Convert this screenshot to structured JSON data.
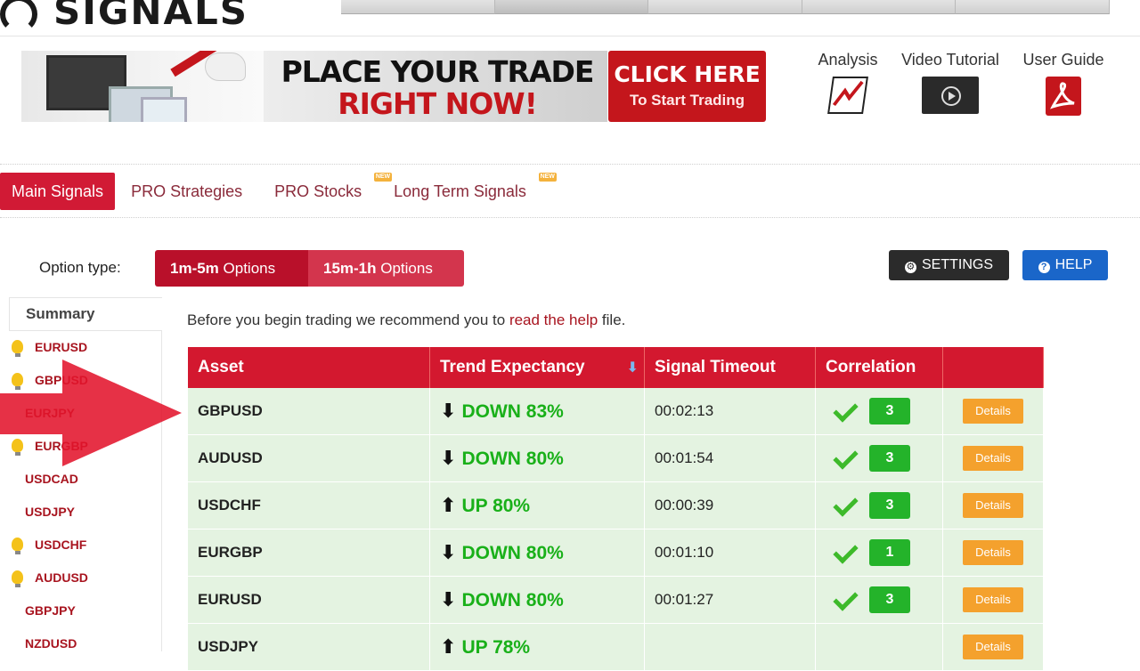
{
  "header": {
    "logo_text": "SIGNALS",
    "top_tabs": [
      "",
      "",
      "",
      "",
      ""
    ]
  },
  "banner": {
    "line1": "PLACE YOUR TRADE",
    "line2": "RIGHT NOW!",
    "cta_line1": "CLICK HERE",
    "cta_line2": "To Start Trading"
  },
  "utility": {
    "analysis": "Analysis",
    "video": "Video Tutorial",
    "guide": "User Guide"
  },
  "tabs": [
    {
      "label": "Main Signals",
      "active": true,
      "new": false
    },
    {
      "label": "PRO Strategies",
      "active": false,
      "new": false
    },
    {
      "label": "PRO Stocks",
      "active": false,
      "new": true
    },
    {
      "label": "Long Term Signals",
      "active": false,
      "new": true
    }
  ],
  "new_badge": "NEW",
  "options": {
    "label": "Option type:",
    "opt1_bold": "1m-5m",
    "opt1_rest": " Options",
    "opt2_bold": "15m-1h",
    "opt2_rest": " Options",
    "settings": "SETTINGS",
    "help": "HELP"
  },
  "summary": {
    "title": "Summary",
    "items": [
      {
        "label": "EURUSD",
        "bulb": true
      },
      {
        "label": "GBPUSD",
        "bulb": true
      },
      {
        "label": "EURJPY",
        "bulb": false
      },
      {
        "label": "EURGBP",
        "bulb": true
      },
      {
        "label": "USDCAD",
        "bulb": false
      },
      {
        "label": "USDJPY",
        "bulb": false
      },
      {
        "label": "USDCHF",
        "bulb": true
      },
      {
        "label": "AUDUSD",
        "bulb": true
      },
      {
        "label": "GBPJPY",
        "bulb": false
      },
      {
        "label": "NZDUSD",
        "bulb": false
      }
    ]
  },
  "intro": {
    "before": "Before you begin trading we recommend you to ",
    "link": "read the help",
    "after": " file."
  },
  "table": {
    "headers": [
      "Asset",
      "Trend Expectancy",
      "Signal Timeout",
      "Correlation",
      ""
    ],
    "rows": [
      {
        "asset": "GBPUSD",
        "dir": "down",
        "trend": "DOWN 83%",
        "timeout": "00:02:13",
        "corr": "3",
        "details": "Details"
      },
      {
        "asset": "AUDUSD",
        "dir": "down",
        "trend": "DOWN 80%",
        "timeout": "00:01:54",
        "corr": "3",
        "details": "Details"
      },
      {
        "asset": "USDCHF",
        "dir": "up",
        "trend": "UP 80%",
        "timeout": "00:00:39",
        "corr": "3",
        "details": "Details"
      },
      {
        "asset": "EURGBP",
        "dir": "down",
        "trend": "DOWN 80%",
        "timeout": "00:01:10",
        "corr": "1",
        "details": "Details"
      },
      {
        "asset": "EURUSD",
        "dir": "down",
        "trend": "DOWN 80%",
        "timeout": "00:01:27",
        "corr": "3",
        "details": "Details"
      },
      {
        "asset": "USDJPY",
        "dir": "up",
        "trend": "UP 78%",
        "timeout": "",
        "corr": "",
        "details": "Details"
      }
    ]
  },
  "colors": {
    "brand_red": "#d3182f",
    "trend_green": "#19b019",
    "details_orange": "#f4a12d",
    "help_blue": "#1a66c9"
  }
}
